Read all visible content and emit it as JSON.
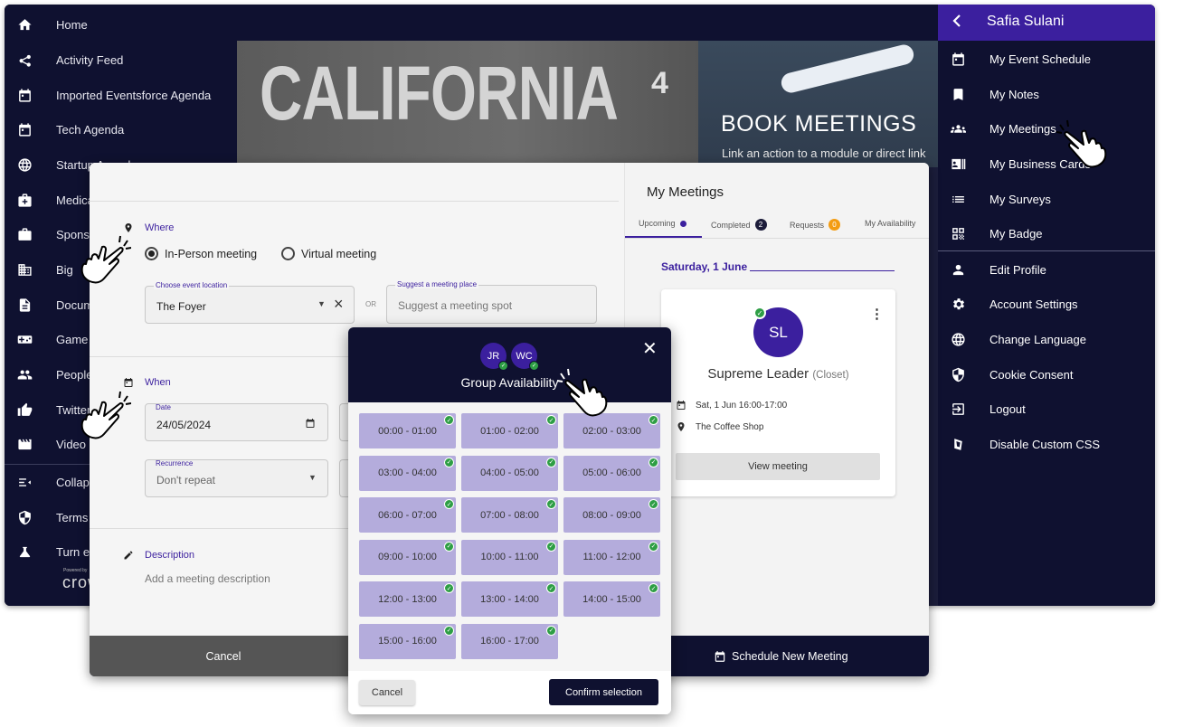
{
  "left_nav": {
    "items": [
      {
        "label": "Home",
        "icon": "home-icon"
      },
      {
        "label": "Activity Feed",
        "icon": "share-icon"
      },
      {
        "label": "Imported Eventsforce Agenda",
        "icon": "calendar-icon"
      },
      {
        "label": "Tech Agenda",
        "icon": "calendar-icon"
      },
      {
        "label": "Startup Agenda",
        "icon": "globe-icon"
      },
      {
        "label": "Medical",
        "icon": "medical-bag-icon"
      },
      {
        "label": "Sponsors",
        "icon": "briefcase-icon"
      },
      {
        "label": "Big",
        "icon": "building-icon"
      },
      {
        "label": "Documents",
        "icon": "document-icon"
      },
      {
        "label": "Game",
        "icon": "gamepad-icon"
      },
      {
        "label": "People",
        "icon": "people-icon"
      },
      {
        "label": "Twitter",
        "icon": "thumbs-up-icon"
      },
      {
        "label": "Video",
        "icon": "film-icon"
      },
      {
        "label": "Collapse",
        "icon": "collapse-icon"
      },
      {
        "label": "Terms",
        "icon": "shield-icon"
      },
      {
        "label": "Turn e",
        "icon": "flask-icon"
      }
    ],
    "powered_by": "Powered by",
    "logo": "crowdcomms"
  },
  "banner": {
    "title": "CALIFORNIA",
    "superscript": "4",
    "promo_title": "BOOK MEETINGS",
    "promo_subtitle": "Link an action to a module or direct link"
  },
  "user_panel": {
    "name": "Safia Sulani",
    "items": [
      {
        "label": "My Event Schedule",
        "icon": "calendar-icon"
      },
      {
        "label": "My Notes",
        "icon": "bookmark-icon"
      },
      {
        "label": "My Meetings",
        "icon": "group-icon"
      },
      {
        "label": "My Business Cards",
        "icon": "business-card-icon"
      },
      {
        "label": "My Surveys",
        "icon": "list-icon"
      },
      {
        "label": "My Badge",
        "icon": "qr-code-icon"
      }
    ],
    "items2": [
      {
        "label": "Edit Profile",
        "icon": "person-icon"
      },
      {
        "label": "Account Settings",
        "icon": "gear-icon"
      },
      {
        "label": "Change Language",
        "icon": "globe-icon"
      },
      {
        "label": "Cookie Consent",
        "icon": "shield-icon"
      },
      {
        "label": "Logout",
        "icon": "logout-icon"
      },
      {
        "label": "Disable Custom CSS",
        "icon": "css-icon"
      }
    ]
  },
  "form": {
    "where_label": "Where",
    "in_person_label": "In-Person meeting",
    "virtual_label": "Virtual meeting",
    "location_label": "Choose event location",
    "location_value": "The Foyer",
    "or_label": "OR",
    "suggest_label": "Suggest a meeting place",
    "suggest_placeholder": "Suggest a meeting spot",
    "when_label": "When",
    "date_label": "Date",
    "date_value": "24/05/2024",
    "recurrence_label": "Recurrence",
    "recurrence_value": "Don't repeat",
    "description_label": "Description",
    "description_placeholder": "Add a meeting description"
  },
  "meetings": {
    "title": "My Meetings",
    "tabs": [
      {
        "label": "Upcoming",
        "badge": ""
      },
      {
        "label": "Completed",
        "badge": "2"
      },
      {
        "label": "Requests",
        "badge": "0"
      },
      {
        "label": "My Availability",
        "badge": ""
      }
    ],
    "date_heading": "Saturday, 1 June",
    "card": {
      "initials": "SL",
      "name": "Supreme Leader",
      "location_room": "(Closet)",
      "time": "Sat, 1 Jun 16:00-17:00",
      "place": "The Coffee Shop",
      "button": "View meeting"
    }
  },
  "bottom": {
    "cancel": "Cancel",
    "schedule": "Schedule New Meeting"
  },
  "group_availability": {
    "avatars": [
      "JR",
      "WC"
    ],
    "title": "Group Availability",
    "slots": [
      "00:00 - 01:00",
      "01:00 - 02:00",
      "02:00 - 03:00",
      "03:00 - 04:00",
      "04:00 - 05:00",
      "05:00 - 06:00",
      "06:00 - 07:00",
      "07:00 - 08:00",
      "08:00 - 09:00",
      "09:00 - 10:00",
      "10:00 - 11:00",
      "11:00 - 12:00",
      "12:00 - 13:00",
      "13:00 - 14:00",
      "14:00 - 15:00",
      "15:00 - 16:00",
      "16:00 - 17:00"
    ],
    "cancel": "Cancel",
    "confirm": "Confirm selection"
  },
  "colors": {
    "navy": "#0f1130",
    "accent": "#3b1f9e",
    "slot": "#b4acdc",
    "check": "#2e9e45",
    "badge_orange": "#f39c12"
  }
}
